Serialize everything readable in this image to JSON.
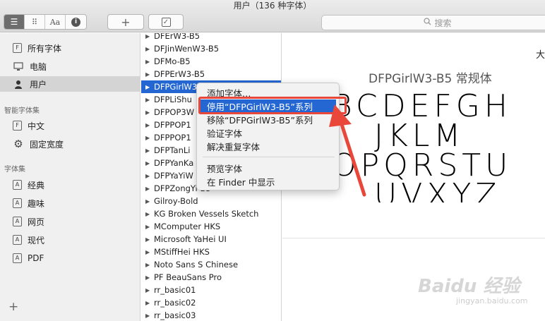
{
  "window": {
    "title": "用户（136 种字体）"
  },
  "toolbar": {
    "view_list_icon": "list-icon",
    "view_grid_icon": "grid-icon",
    "sample_label": "Aa",
    "info_icon": "info-icon",
    "add_label": "+",
    "validate_label": "✓",
    "search_placeholder": "搜索"
  },
  "sidebar": {
    "items": [
      {
        "label": "所有字体",
        "icon": "F"
      },
      {
        "label": "电脑"
      },
      {
        "label": "用户"
      }
    ],
    "smart_header": "智能字体集",
    "smart_items": [
      {
        "label": "中文",
        "icon": "F"
      },
      {
        "label": "固定宽度"
      }
    ],
    "collections_header": "字体集",
    "collections": [
      {
        "label": "经典",
        "icon": "A"
      },
      {
        "label": "趣味",
        "icon": "A"
      },
      {
        "label": "网页",
        "icon": "A"
      },
      {
        "label": "现代",
        "icon": "A"
      },
      {
        "label": "PDF",
        "icon": "A"
      }
    ],
    "add_label": "+"
  },
  "font_list": [
    "DFErW3-B5",
    "DFJinWenW3-B5",
    "DFMo-B5",
    "DFPErW3-B5",
    "DFPGirlW3-B5",
    "DFPLiShu",
    "DFPOP3W",
    "DFPPOP1",
    "DFPPOP1",
    "DFPTanLi",
    "DFPYanKa",
    "DFPYaYiW",
    "DFPZongYi-B5",
    "Gilroy-Bold",
    "KG Broken Vessels Sketch",
    "MComputer HKS",
    "Microsoft YaHei UI",
    "MStiffHei HKS",
    "Noto Sans S Chinese",
    "PF BeauSans Pro",
    "rr_basic01",
    "rr_basic02",
    "rr_basic03"
  ],
  "preview": {
    "size_label": "大",
    "title": "DFPGirlW3-B5 常规体",
    "lines": [
      "BCDEFGH",
      "JKLM",
      "OPQRSTU",
      "UVXYZ"
    ]
  },
  "context_menu": {
    "items": [
      "添加字体…",
      "停用“DFPGirlW3-B5”系列",
      "移除“DFPGirlW3-B5”系列",
      "验证字体",
      "解决重复字体",
      "预览字体",
      "在 Finder 中显示"
    ]
  },
  "watermark": {
    "text": "Baidu 经验",
    "url": "jingyan.baidu.com"
  },
  "colors": {
    "selection": "#2467d3",
    "highlight_box": "#e8473a"
  }
}
